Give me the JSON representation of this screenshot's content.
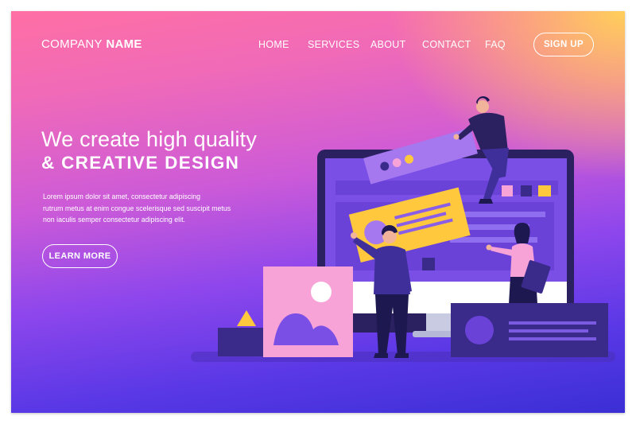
{
  "header": {
    "brand_company": "COMPANY",
    "brand_name": "NAME",
    "nav": [
      "HOME",
      "SERVICES",
      "ABOUT",
      "CONTACT",
      "FAQ"
    ],
    "signup_label": "SIGN UP"
  },
  "hero": {
    "title_line1": "We create high quality",
    "title_line2": "& CREATIVE DESIGN",
    "description": [
      "Lorem ipsum dolor sit amet, consectetur adipiscing",
      "rutrum metus at enim congue scelerisque sed suscipit metus",
      "non iaculis semper consectetur adipiscing elit."
    ],
    "cta_label": "LEARN MORE"
  },
  "illustration": {
    "icons": [
      "desktop-monitor-icon",
      "image-card-icon",
      "triangle-icon",
      "profile-card-icon"
    ],
    "colors": {
      "monitor_frame": "#2b2160",
      "screen": "#7a4fe6",
      "yellow": "#ffc83d",
      "pink": "#f7a3d8",
      "navy": "#3a2a8a"
    }
  }
}
